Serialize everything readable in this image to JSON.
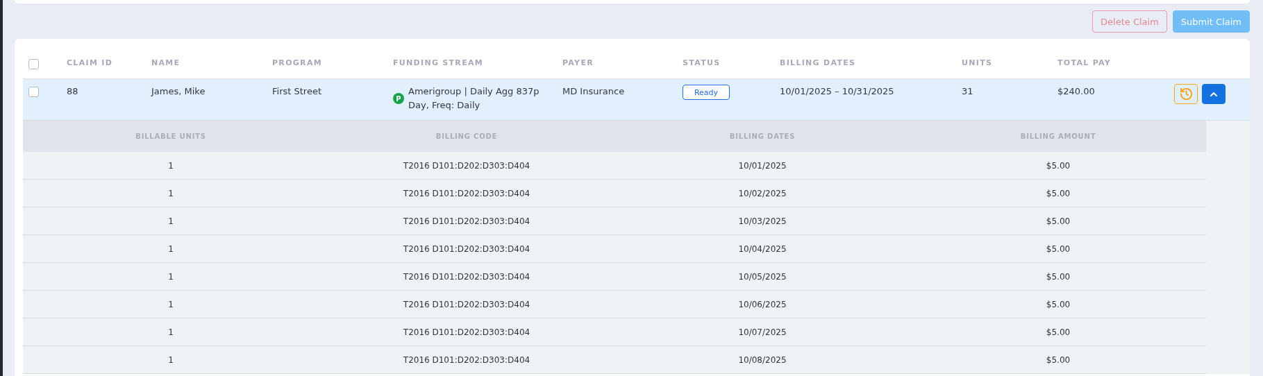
{
  "actions": [
    {
      "label": "Delete Claim",
      "kind": "danger",
      "disabled": true
    },
    {
      "label": "Submit Claim",
      "kind": "primary",
      "disabled": true
    }
  ],
  "table": {
    "select_all": {
      "checked": false
    },
    "columns": [
      "CLAIM ID",
      "NAME",
      "PROGRAM",
      "FUNDING STREAM",
      "PAYER",
      "STATUS",
      "BILLING DATES",
      "UNITS",
      "TOTAL PAY"
    ],
    "rows": [
      {
        "checked": false,
        "selected": true,
        "expanded": true,
        "claim_id": "88",
        "name": "James, Mike",
        "program": "First Street",
        "funding_badge": "P",
        "funding_stream": "Amerigroup | Daily Agg 837p Day, Freq: Daily",
        "payer": "MD Insurance",
        "status": "Ready",
        "billing_dates": "10/01/2025 – 10/31/2025",
        "units": "31",
        "total_pay": "$240.00",
        "details": {
          "columns": [
            "BILLABLE UNITS",
            "BILLING CODE",
            "BILLING DATES",
            "BILLING AMOUNT"
          ],
          "rows": [
            [
              "1",
              "T2016 D101:D202:D303:D404",
              "10/01/2025",
              "$5.00"
            ],
            [
              "1",
              "T2016 D101:D202:D303:D404",
              "10/02/2025",
              "$5.00"
            ],
            [
              "1",
              "T2016 D101:D202:D303:D404",
              "10/03/2025",
              "$5.00"
            ],
            [
              "1",
              "T2016 D101:D202:D303:D404",
              "10/04/2025",
              "$5.00"
            ],
            [
              "1",
              "T2016 D101:D202:D303:D404",
              "10/05/2025",
              "$5.00"
            ],
            [
              "1",
              "T2016 D101:D202:D303:D404",
              "10/06/2025",
              "$5.00"
            ],
            [
              "1",
              "T2016 D101:D202:D303:D404",
              "10/07/2025",
              "$5.00"
            ],
            [
              "1",
              "T2016 D101:D202:D303:D404",
              "10/08/2025",
              "$5.00"
            ]
          ]
        }
      }
    ]
  }
}
